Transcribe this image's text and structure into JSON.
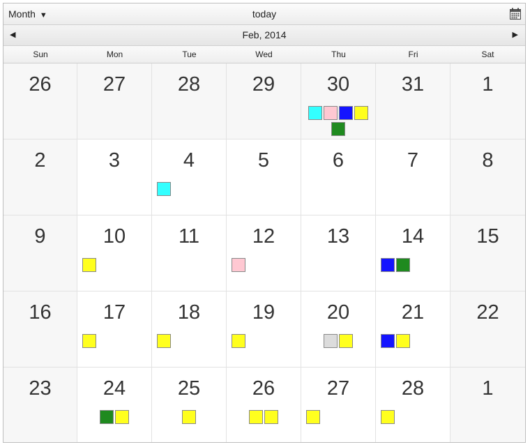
{
  "toolbar": {
    "view_label": "Month",
    "view_arrow": "▼",
    "today_label": "today",
    "calendar_icon": "calendar-icon"
  },
  "nav": {
    "prev": "◀",
    "next": "▶",
    "month_title": "Feb, 2014"
  },
  "weekdays": [
    "Sun",
    "Mon",
    "Tue",
    "Wed",
    "Thu",
    "Fri",
    "Sat"
  ],
  "event_colors": {
    "cyan": "#33ffff",
    "pink": "#ffc8d2",
    "blue": "#1414ff",
    "yellow": "#ffff1e",
    "green": "#1f8a1f",
    "gray": "#dcdcdc"
  },
  "weeks": [
    [
      {
        "day": "26",
        "other": true,
        "events": []
      },
      {
        "day": "27",
        "other": true,
        "events": []
      },
      {
        "day": "28",
        "other": true,
        "events": []
      },
      {
        "day": "29",
        "other": true,
        "events": []
      },
      {
        "day": "30",
        "other": true,
        "events": [
          "cyan",
          "pink",
          "blue",
          "yellow",
          "green"
        ]
      },
      {
        "day": "31",
        "other": true,
        "events": []
      },
      {
        "day": "1",
        "other": false,
        "events": []
      }
    ],
    [
      {
        "day": "2",
        "other": false,
        "events": []
      },
      {
        "day": "3",
        "other": false,
        "events": []
      },
      {
        "day": "4",
        "other": false,
        "events": [
          "cyan"
        ]
      },
      {
        "day": "5",
        "other": false,
        "events": []
      },
      {
        "day": "6",
        "other": false,
        "events": []
      },
      {
        "day": "7",
        "other": false,
        "events": []
      },
      {
        "day": "8",
        "other": false,
        "events": []
      }
    ],
    [
      {
        "day": "9",
        "other": false,
        "events": []
      },
      {
        "day": "10",
        "other": false,
        "events": [
          "yellow"
        ]
      },
      {
        "day": "11",
        "other": false,
        "events": []
      },
      {
        "day": "12",
        "other": false,
        "events": [
          "pink"
        ]
      },
      {
        "day": "13",
        "other": false,
        "events": []
      },
      {
        "day": "14",
        "other": false,
        "events": [
          "blue",
          "green"
        ]
      },
      {
        "day": "15",
        "other": false,
        "events": []
      }
    ],
    [
      {
        "day": "16",
        "other": false,
        "events": []
      },
      {
        "day": "17",
        "other": false,
        "events": [
          "yellow"
        ]
      },
      {
        "day": "18",
        "other": false,
        "events": [
          "yellow"
        ]
      },
      {
        "day": "19",
        "other": false,
        "events": [
          "yellow"
        ]
      },
      {
        "day": "20",
        "other": false,
        "events": [
          "gray",
          "yellow"
        ]
      },
      {
        "day": "21",
        "other": false,
        "events": [
          "blue",
          "yellow"
        ]
      },
      {
        "day": "22",
        "other": false,
        "events": []
      }
    ],
    [
      {
        "day": "23",
        "other": false,
        "events": []
      },
      {
        "day": "24",
        "other": false,
        "events": [
          "green",
          "yellow"
        ]
      },
      {
        "day": "25",
        "other": false,
        "events": [
          "yellow"
        ]
      },
      {
        "day": "26",
        "other": false,
        "events": [
          "yellow",
          "yellow"
        ]
      },
      {
        "day": "27",
        "other": false,
        "events": [
          "yellow"
        ]
      },
      {
        "day": "28",
        "other": false,
        "events": [
          "yellow"
        ]
      },
      {
        "day": "1",
        "other": true,
        "events": []
      }
    ]
  ]
}
